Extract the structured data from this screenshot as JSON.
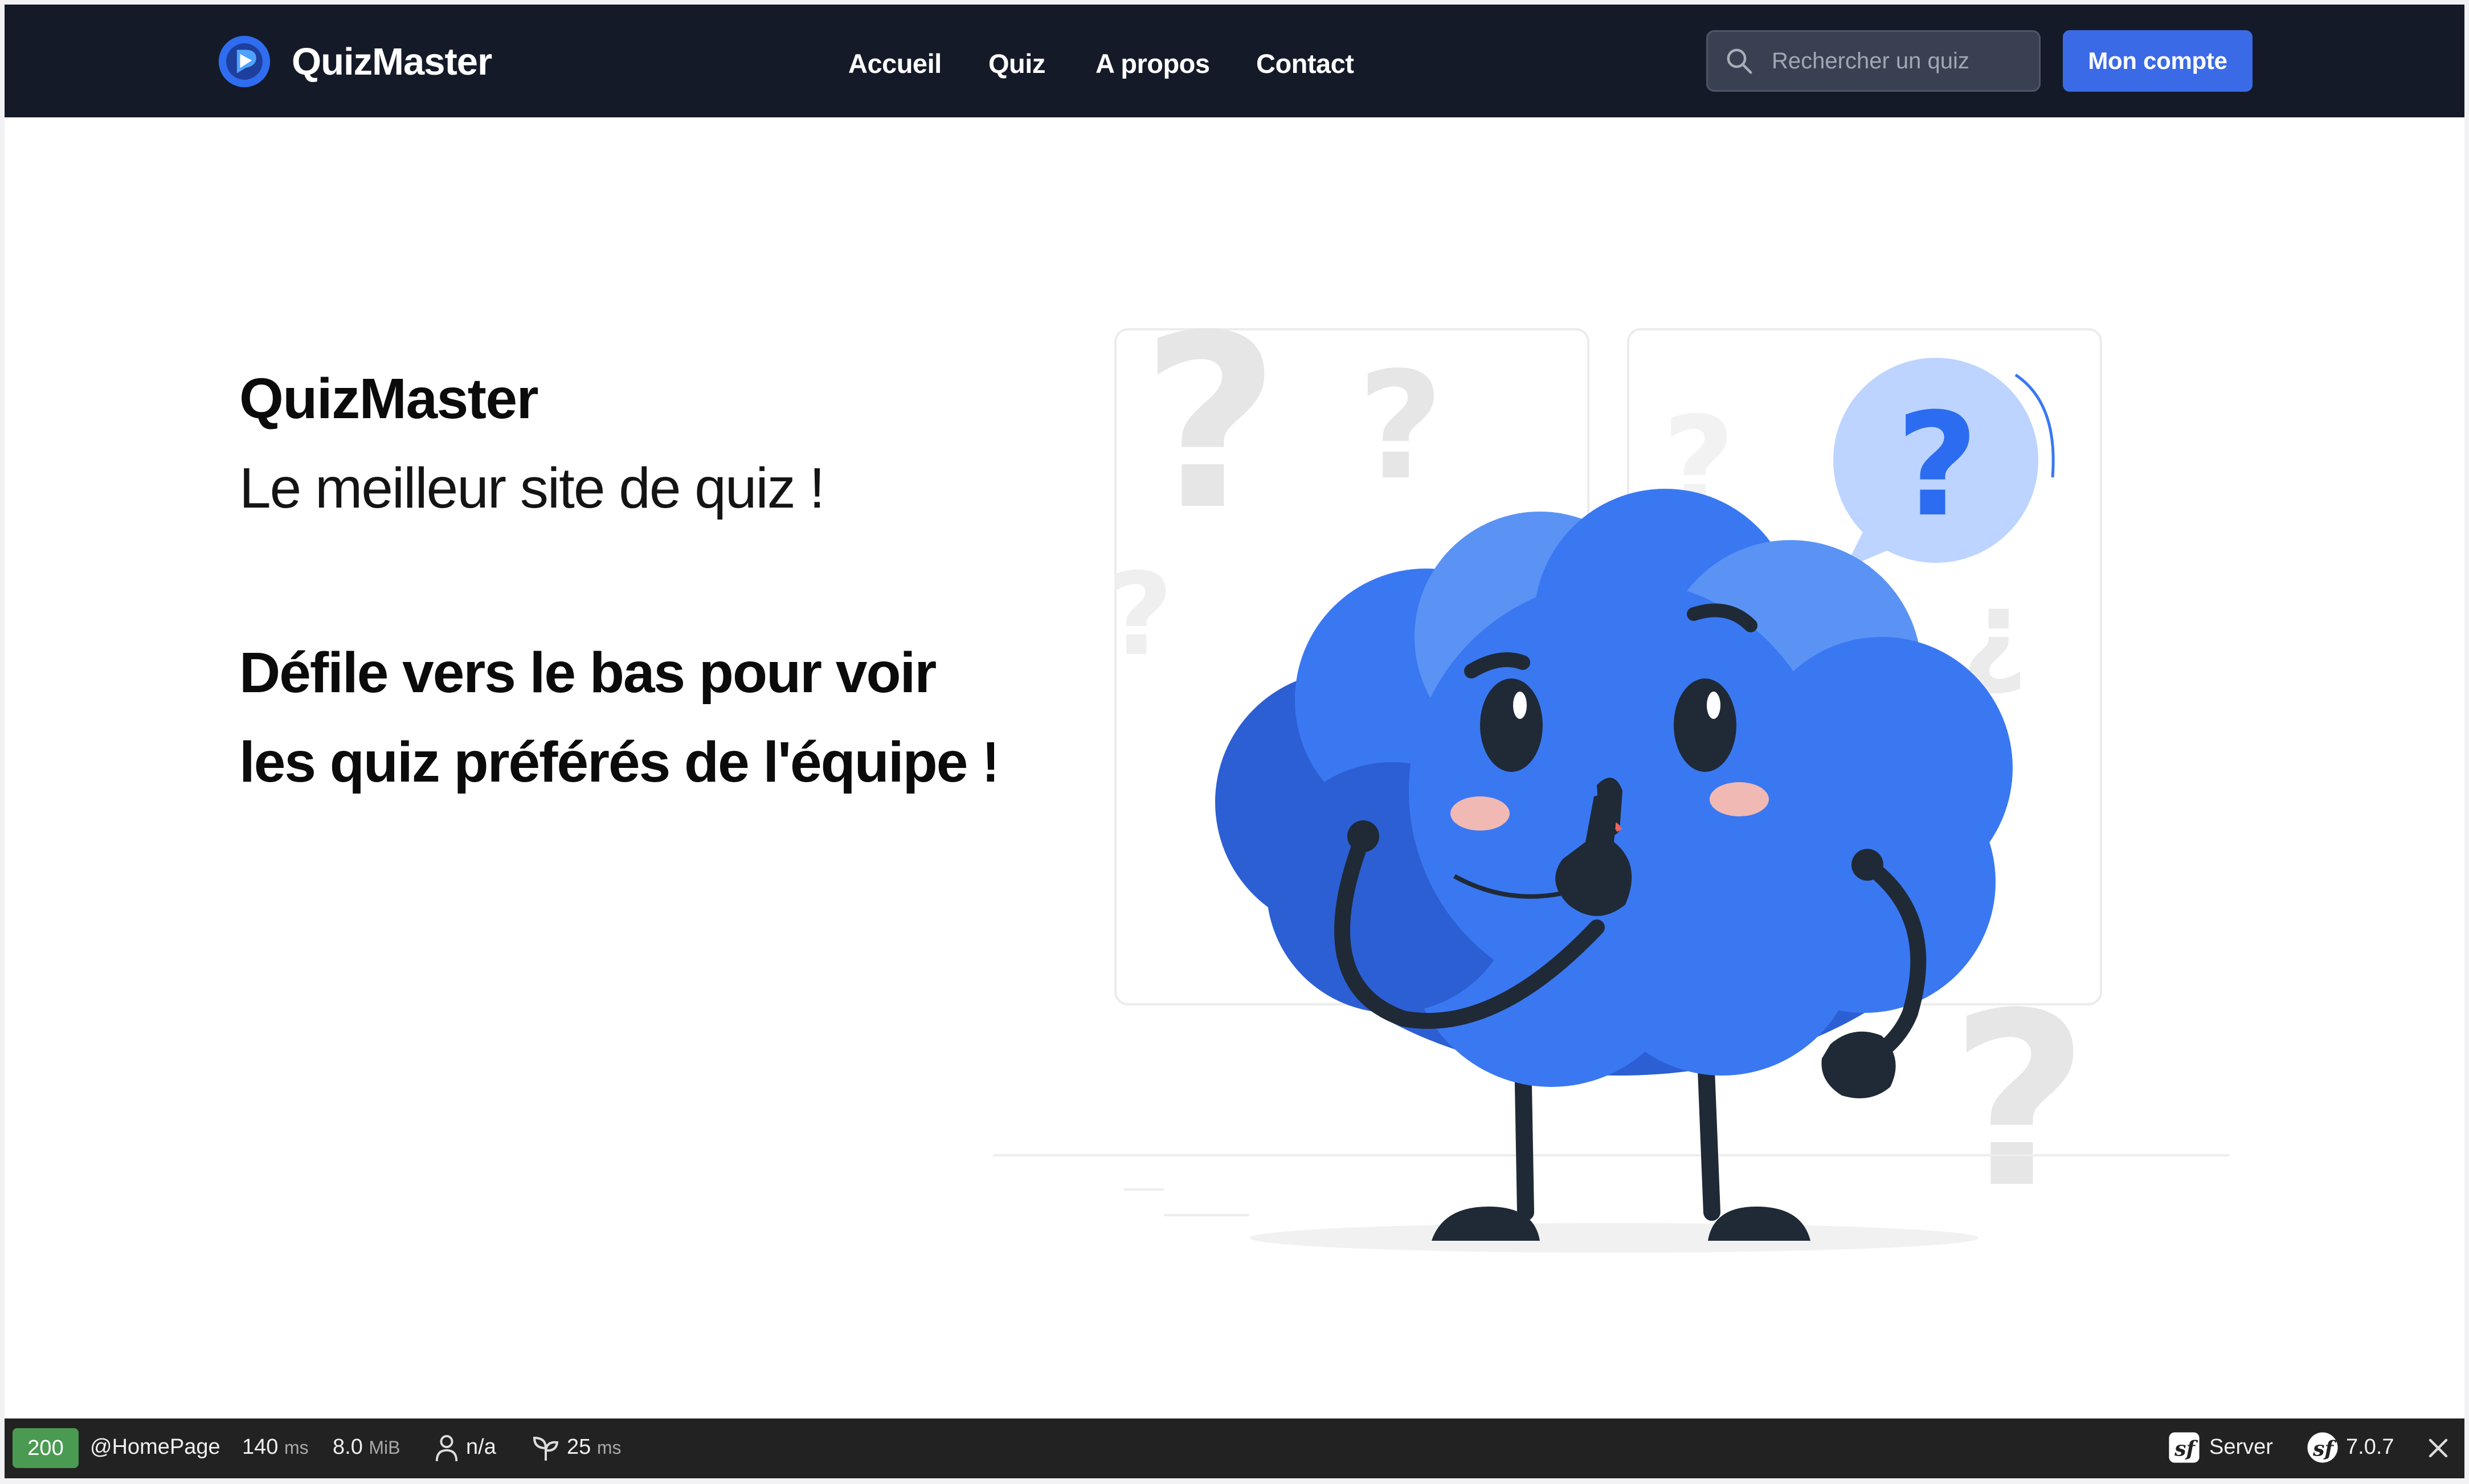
{
  "navbar": {
    "brand": "QuizMaster",
    "links": [
      {
        "label": "Accueil"
      },
      {
        "label": "Quiz"
      },
      {
        "label": "A propos"
      },
      {
        "label": "Contact"
      }
    ],
    "search_placeholder": "Rechercher un quiz",
    "account_button": "Mon compte"
  },
  "hero": {
    "title": "QuizMaster",
    "subtitle": "Le meilleur site de quiz !",
    "cta_line1": "Défile vers le bas pour voir",
    "cta_line2": "les quiz préférés de l'équipe !",
    "illustration_icon": "thinking-brain-icon"
  },
  "debug_toolbar": {
    "status_code": "200",
    "route": "@HomePage",
    "time_value": "140",
    "time_unit": "ms",
    "memory_value": "8.0",
    "memory_unit": "MiB",
    "user": "n/a",
    "init_value": "25",
    "init_unit": "ms",
    "server_label": "Server",
    "symfony_version": "7.0.7"
  },
  "colors": {
    "navbar_bg": "#141a28",
    "accent": "#3a6ae6",
    "brain_blue": "#3a78f2",
    "status_ok": "#4b9a52",
    "toolbar_bg": "#222222"
  }
}
